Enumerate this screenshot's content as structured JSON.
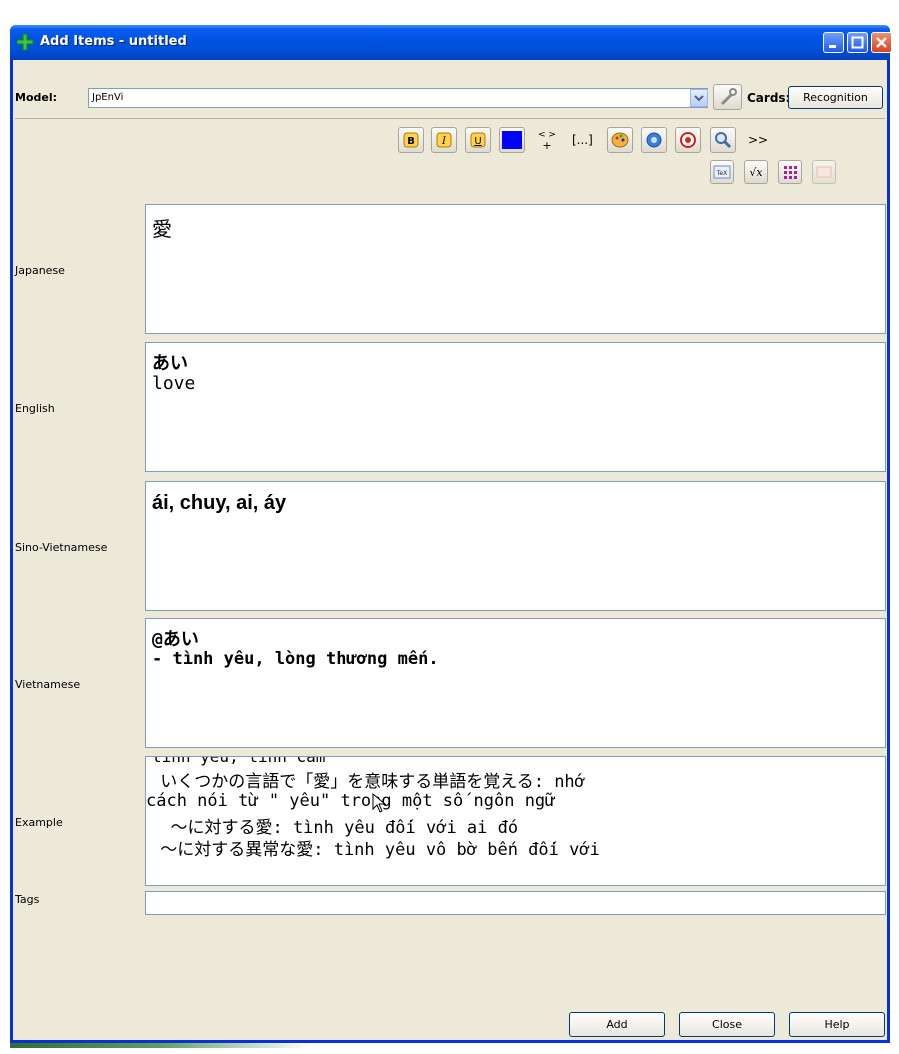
{
  "window": {
    "title": "Add Items - untitled"
  },
  "model": {
    "label": "Model:",
    "value": "JpEnVi"
  },
  "cards": {
    "label": "Cards:",
    "button": "Recognition"
  },
  "toolbar": {
    "bold": "B",
    "italic": "I",
    "underline": "U",
    "cloze": "[...]",
    "more": ">>",
    "tex": "TeX",
    "sqrt": "√x"
  },
  "fields": {
    "japanese": {
      "label": "Japanese",
      "value": "愛"
    },
    "english": {
      "label": "English",
      "line1": "あい",
      "line2": "love"
    },
    "sino": {
      "label": "Sino-Vietnamese",
      "value": "ái, chuy, ai, áy"
    },
    "vietnamese": {
      "label": "Vietnamese",
      "line1": "@あい",
      "line2": "- tình yêu, lòng thương mến."
    },
    "example": {
      "label": "Example",
      "line0": "tình yêu, tình cảm",
      "line1": " いくつかの言語で「愛」を意味する単語を覚える: nhớ",
      "line2": "cách nói từ \" yêu\" trong một số ngôn ngữ",
      "line3": "  ～に対する愛: tình yêu đối với ai đó",
      "line4": " ～に対する異常な愛: tình yêu vô bờ bến đối với"
    },
    "tags": {
      "label": "Tags",
      "value": ""
    }
  },
  "buttons": {
    "add": "Add",
    "close": "Close",
    "help": "Help"
  },
  "colors": {
    "titlebar": "#0054e3",
    "text_color_swatch": "#0000ff"
  }
}
